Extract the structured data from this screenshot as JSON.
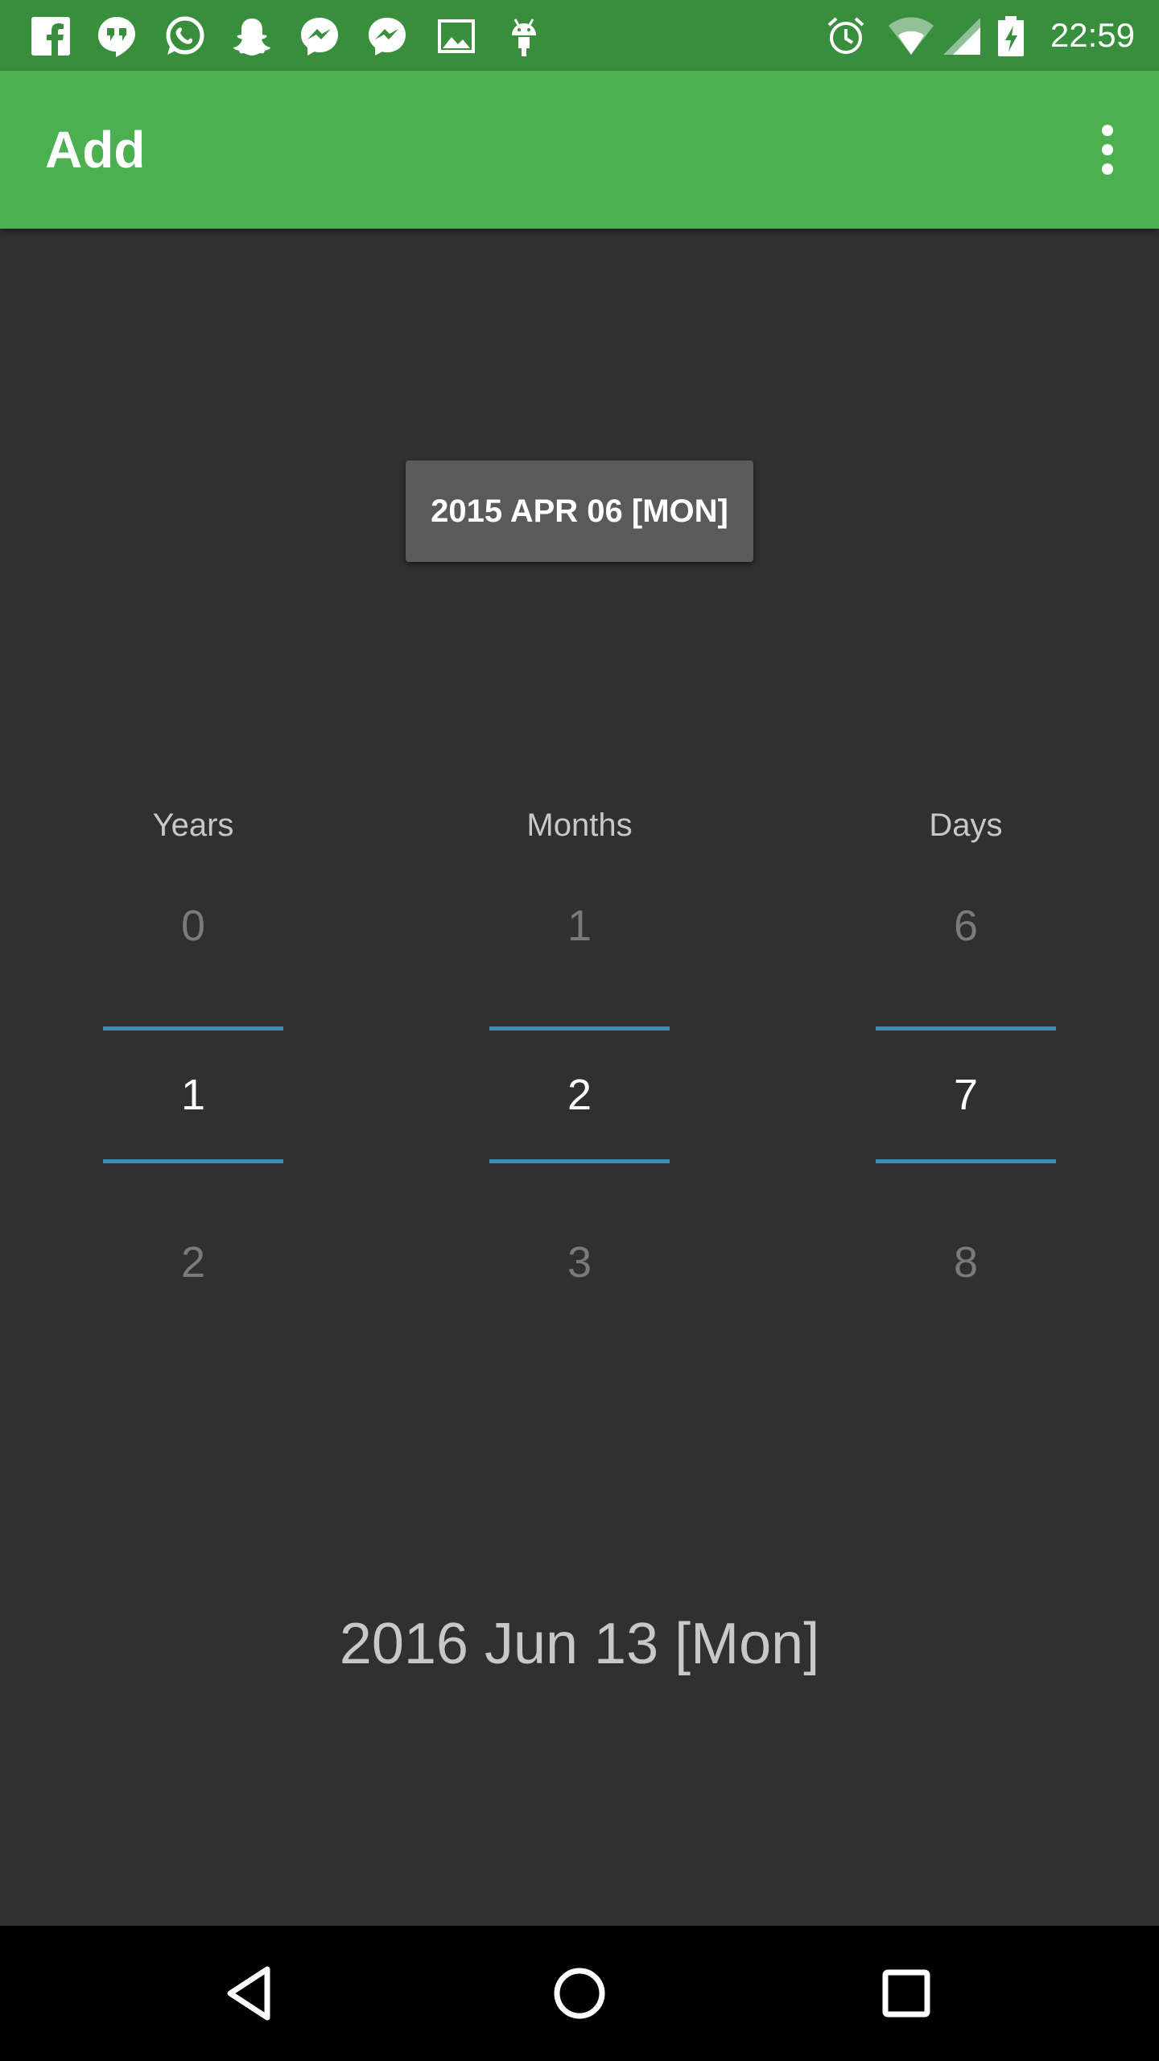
{
  "status_bar": {
    "time": "22:59",
    "icons": [
      "facebook-icon",
      "hangouts-icon",
      "whatsapp-icon",
      "snapchat-icon",
      "messenger-icon",
      "messenger-icon",
      "gallery-icon",
      "android-debug-icon",
      "alarm-icon",
      "wifi-icon",
      "signal-icon",
      "battery-charging-icon"
    ]
  },
  "app_bar": {
    "title": "Add",
    "overflow_icon": "more-vert-icon",
    "background": "#4CAF50"
  },
  "date_button": {
    "label": "2015 APR 06 [MON]"
  },
  "pickers": {
    "years": {
      "label": "Years",
      "prev": "0",
      "current": "1",
      "next": "2"
    },
    "months": {
      "label": "Months",
      "prev": "1",
      "current": "2",
      "next": "3"
    },
    "days": {
      "label": "Days",
      "prev": "6",
      "current": "7",
      "next": "8"
    },
    "accent": "#3c8fb8"
  },
  "result": {
    "date": "2016 Jun 13 [Mon]"
  },
  "nav_bar": {
    "icons": [
      "back-icon",
      "home-icon",
      "recents-icon"
    ]
  }
}
